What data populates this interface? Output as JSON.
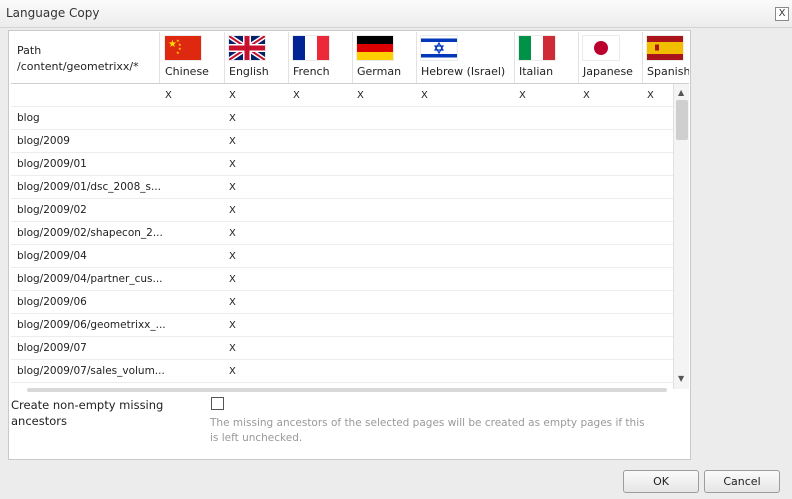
{
  "window": {
    "title": "Language Copy",
    "close_label": "X"
  },
  "grid": {
    "path_header_line1": "Path",
    "path_header_line2": "/content/geometrixx/*",
    "languages": [
      {
        "label": "Chinese",
        "flag": "china-flag"
      },
      {
        "label": "English",
        "flag": "uk-flag"
      },
      {
        "label": "French",
        "flag": "france-flag"
      },
      {
        "label": "German",
        "flag": "germany-flag"
      },
      {
        "label": "Hebrew (Israel)",
        "flag": "israel-flag"
      },
      {
        "label": "Italian",
        "flag": "italy-flag"
      },
      {
        "label": "Japanese",
        "flag": "japan-flag"
      },
      {
        "label": "Spanish",
        "flag": "spain-flag"
      }
    ],
    "mark": "X",
    "rows": [
      {
        "path": "",
        "marks": [
          "X",
          "X",
          "X",
          "X",
          "X",
          "X",
          "X",
          "X"
        ]
      },
      {
        "path": "blog",
        "marks": [
          "",
          "X",
          "",
          "",
          "",
          "",
          "",
          ""
        ]
      },
      {
        "path": "blog/2009",
        "marks": [
          "",
          "X",
          "",
          "",
          "",
          "",
          "",
          ""
        ]
      },
      {
        "path": "blog/2009/01",
        "marks": [
          "",
          "X",
          "",
          "",
          "",
          "",
          "",
          ""
        ]
      },
      {
        "path": "blog/2009/01/dsc_2008_s...",
        "marks": [
          "",
          "X",
          "",
          "",
          "",
          "",
          "",
          ""
        ]
      },
      {
        "path": "blog/2009/02",
        "marks": [
          "",
          "X",
          "",
          "",
          "",
          "",
          "",
          ""
        ]
      },
      {
        "path": "blog/2009/02/shapecon_2...",
        "marks": [
          "",
          "X",
          "",
          "",
          "",
          "",
          "",
          ""
        ]
      },
      {
        "path": "blog/2009/04",
        "marks": [
          "",
          "X",
          "",
          "",
          "",
          "",
          "",
          ""
        ]
      },
      {
        "path": "blog/2009/04/partner_cus...",
        "marks": [
          "",
          "X",
          "",
          "",
          "",
          "",
          "",
          ""
        ]
      },
      {
        "path": "blog/2009/06",
        "marks": [
          "",
          "X",
          "",
          "",
          "",
          "",
          "",
          ""
        ]
      },
      {
        "path": "blog/2009/06/geometrixx_...",
        "marks": [
          "",
          "X",
          "",
          "",
          "",
          "",
          "",
          ""
        ]
      },
      {
        "path": "blog/2009/07",
        "marks": [
          "",
          "X",
          "",
          "",
          "",
          "",
          "",
          ""
        ]
      },
      {
        "path": "blog/2009/07/sales_volum...",
        "marks": [
          "",
          "X",
          "",
          "",
          "",
          "",
          "",
          ""
        ]
      }
    ]
  },
  "option": {
    "label": "Create non-empty missing ancestors",
    "checked": false,
    "hint": "The missing ancestors of the selected pages will be created as empty pages if this is left unchecked."
  },
  "buttons": {
    "ok": "OK",
    "cancel": "Cancel"
  }
}
